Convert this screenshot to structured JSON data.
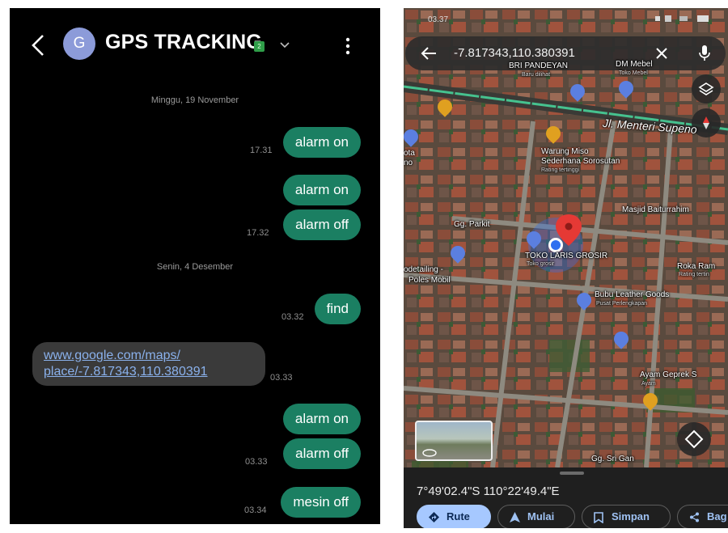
{
  "sms": {
    "contact_name": "GPS TRACKING",
    "avatar_letter": "G",
    "sim_badge": "2",
    "date_separators": [
      "Minggu, 19 November",
      "Senin, 4 Desember"
    ],
    "timestamps": [
      "17.31",
      "17.32",
      "03.32",
      "03.33",
      "03.33",
      "03.34"
    ],
    "messages": {
      "m1": "alarm on",
      "m2": "alarm on",
      "m3": "alarm off",
      "m4": "find",
      "incoming_line1": "www.google.com/maps/",
      "incoming_line2": "place/-7.817343,110.380391",
      "m5": "alarm on",
      "m6": "alarm off",
      "m7": "mesin off"
    },
    "colors": {
      "outgoing_bubble": "#1b7f62",
      "incoming_bubble": "#3a3a3a",
      "link": "#8ab1ec"
    }
  },
  "map": {
    "status_time": "03.37",
    "search_value": "-7.817343,110.380391",
    "labels": {
      "bri": "BRI PANDEYAN",
      "bri_sub": "Baru dilihat",
      "dm": "DM Mebel",
      "dm_sub": "Toko Mebel",
      "road": "Jl. Menteri Supeno",
      "warung1": "Warung Miso",
      "warung2": "Sederhana Sorosutan",
      "warung_sub": "Rating tertinggi",
      "masjid": "Masjid Baiturrahim",
      "gg_parkit": "Gg. Parkit",
      "toko": "TOKO LARIS GROSIR",
      "toko_sub": "Toko grosir",
      "roka": "Roka Ram",
      "roka_sub": "Rating tertin",
      "detailing1": "odetailing -",
      "detailing2": "Poles Mobil",
      "bubu": "Bubu Leather Goods",
      "bubu_sub": "Pusat Perlengkapan",
      "ayam": "Ayam Geprek S",
      "ayam_sub": "Ayam",
      "gg_sri": "Gg. Sri Gan",
      "left_cut1": "ota",
      "left_cut2": "no"
    },
    "coordinates": "7°49'02.4\"S 110°22'49.4\"E",
    "actions": {
      "route": "Rute",
      "start": "Mulai",
      "save": "Simpan",
      "share": "Bag"
    },
    "colors": {
      "primary_chip": "#a6c8ff",
      "chip_text": "#9fc2f3",
      "pin": "#e53935",
      "location_dot": "#2f6ff0",
      "road": "#46c28f"
    }
  }
}
